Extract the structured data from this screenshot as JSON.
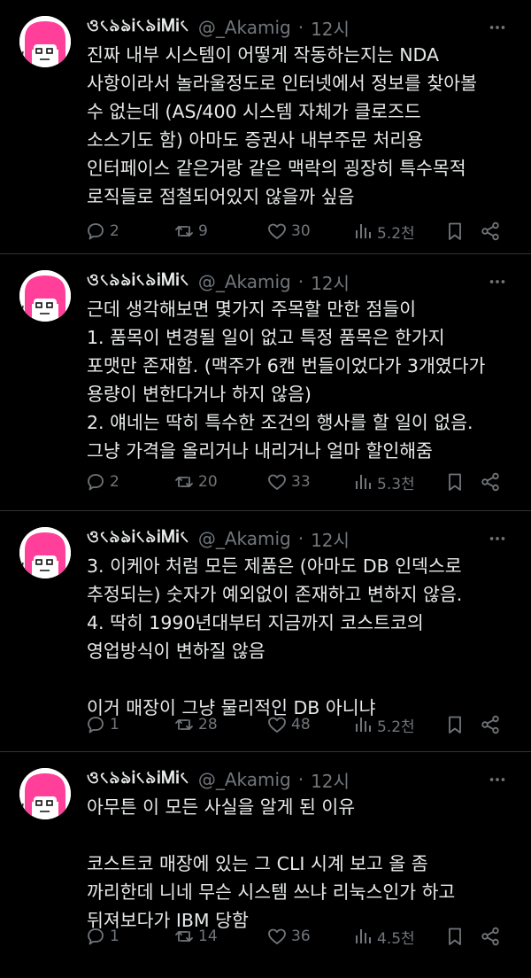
{
  "colors": {
    "background": "#000000",
    "text": "#e7e9ea",
    "muted": "#71767b",
    "divider": "#2f3336",
    "avatar_hair": "#ff3f9a"
  },
  "icons": {
    "reply": "speech-bubble-icon",
    "retweet": "retweet-icon",
    "like": "heart-icon",
    "views": "bar-chart-icon",
    "bookmark": "bookmark-icon",
    "share": "share-icon",
    "more": "more-dots-icon"
  },
  "tweets": [
    {
      "display_name": "ও৻৯ঌᎥ৻৯ᎥᎷᎥ৻",
      "handle": "@_Akamig",
      "dot": "·",
      "time": "12시",
      "text": "진짜 내부 시스템이 어떻게 작동하는지는 NDA\n사항이라서 놀라울정도로 인터넷에서 정보를 찾아볼\n수 없는데 (AS/400 시스템 자체가 클로즈드\n소스기도 함) 아마도 증권사 내부주문 처리용\n인터페이스 같은거랑 같은 맥락의 굉장히 특수목적\n로직들로 점철되어있지 않을까 싶음",
      "replies": "2",
      "retweets": "9",
      "likes": "30",
      "views": "5.2천"
    },
    {
      "display_name": "ও৻৯ঌᎥ৻৯ᎥᎷᎥ৻",
      "handle": "@_Akamig",
      "dot": "·",
      "time": "12시",
      "text": "근데 생각해보면 몇가지 주목할 만한 점들이\n1. 품목이 변경될 일이 없고 특정 품목은 한가지\n포맷만 존재함. (맥주가 6캔 번들이었다가 3개였다가\n용량이 변한다거나 하지 않음)\n2. 얘네는 딱히 특수한 조건의 행사를 할 일이 없음.\n그냥 가격을 올리거나 내리거나 얼마 할인해줌",
      "replies": "2",
      "retweets": "20",
      "likes": "33",
      "views": "5.3천"
    },
    {
      "display_name": "ও৻৯ঌᎥ৻৯ᎥᎷᎥ৻",
      "handle": "@_Akamig",
      "dot": "·",
      "time": "12시",
      "text": "3. 이케아 처럼 모든 제품은 (아마도 DB 인덱스로\n추정되는) 숫자가 예외없이 존재하고 변하지 않음.\n4. 딱히 1990년대부터 지금까지 코스트코의\n영업방식이 변하질 않음\n\n이거 매장이 그냥 물리적인 DB 아니냐",
      "replies": "1",
      "retweets": "28",
      "likes": "48",
      "views": "5.2천"
    },
    {
      "display_name": "ও৻৯ঌᎥ৻৯ᎥᎷᎥ৻",
      "handle": "@_Akamig",
      "dot": "·",
      "time": "12시",
      "text": "아무튼 이 모든 사실을 알게 된 이유\n\n코스트코 매장에 있는 그 CLI 시계 보고 올 좀\n까리한데 니네 무슨 시스템 쓰냐 리눅스인가 하고\n뒤져보다가 IBM 당함",
      "replies": "1",
      "retweets": "14",
      "likes": "36",
      "views": "4.5천"
    }
  ]
}
